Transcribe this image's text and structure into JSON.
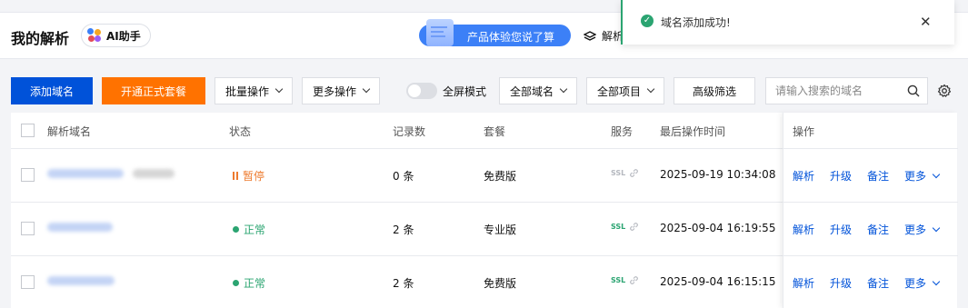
{
  "header": {
    "title": "我的解析",
    "ai_button": "AI助手",
    "promo": "产品体验您说了算",
    "parse_tab": "解析"
  },
  "toast": {
    "message": "域名添加成功!",
    "icon": "check-circle-icon",
    "close_icon": "close-icon",
    "color": "#2ba471"
  },
  "toolbar": {
    "add_domain": "添加域名",
    "open_package": "开通正式套餐",
    "batch_ops": "批量操作",
    "more_ops": "更多操作",
    "fullscreen_label": "全屏模式",
    "fullscreen_on": false,
    "all_domains": "全部域名",
    "all_projects": "全部项目",
    "advanced_filter": "高级筛选",
    "search_placeholder": "请输入搜索的域名"
  },
  "table": {
    "columns": {
      "domain": "解析域名",
      "status": "状态",
      "records": "记录数",
      "package": "套餐",
      "service": "服务",
      "last_op": "最后操作时间",
      "actions": "操作"
    },
    "rows": [
      {
        "status": "暂停",
        "status_color": "#ed7b2f",
        "records": "0 条",
        "package": "免费版",
        "ssl": "SSL",
        "ssl_color": "#b5b8bf",
        "last_op": "2025-09-19 10:34:08"
      },
      {
        "status": "正常",
        "status_color": "#2ba471",
        "records": "2 条",
        "package": "专业版",
        "ssl": "SSL",
        "ssl_color": "#2ba471",
        "last_op": "2025-09-04 16:19:55"
      },
      {
        "status": "正常",
        "status_color": "#2ba471",
        "records": "2 条",
        "package": "免费版",
        "ssl": "SSL",
        "ssl_color": "#2ba471",
        "last_op": "2025-09-04 16:15:15"
      }
    ],
    "actions": {
      "parse": "解析",
      "upgrade": "升级",
      "note": "备注",
      "more": "更多"
    }
  },
  "colors": {
    "primary": "#0052d9",
    "orange": "#ff7200",
    "success": "#2ba471",
    "warning": "#ed7b2f"
  }
}
